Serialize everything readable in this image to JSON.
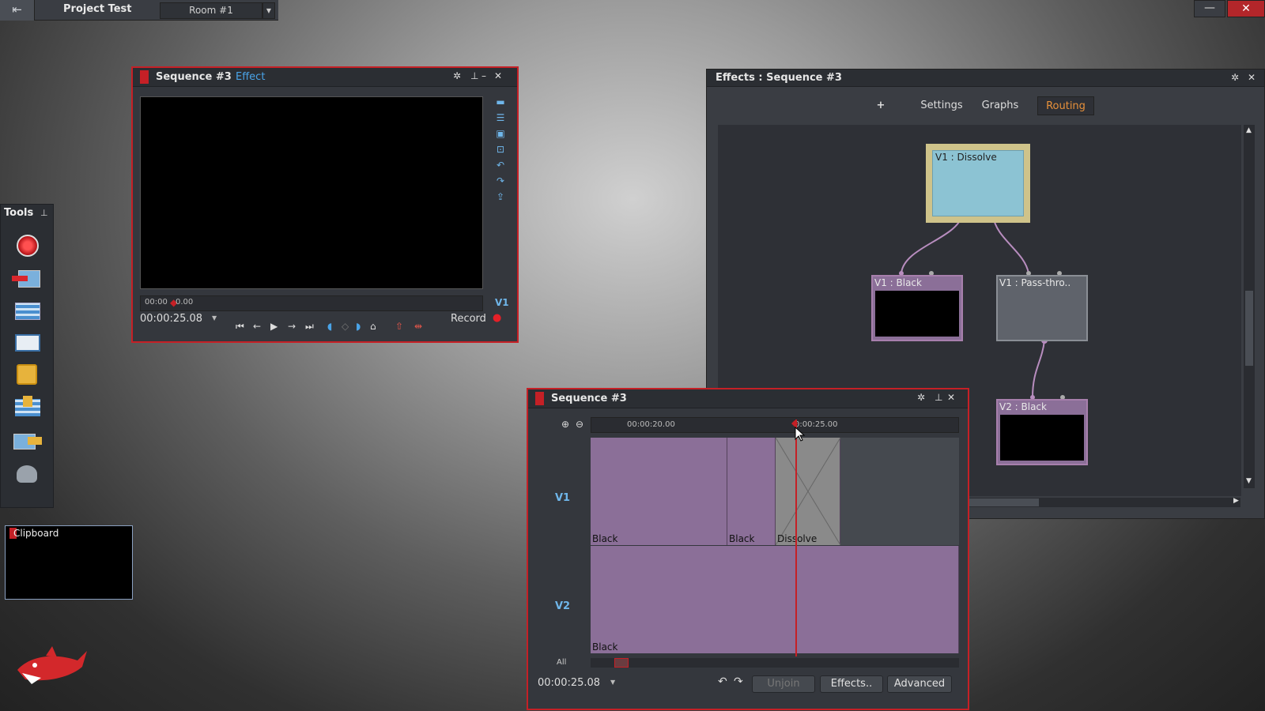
{
  "top_bar": {
    "project_title": "Project Test",
    "room": "Room #1",
    "exit_icon": "exit-icon",
    "dropdown_icon": "chevron-down-icon",
    "minimize_label": "—",
    "close_label": "✕"
  },
  "monitor": {
    "title": "Sequence #3",
    "subtitle": "Effect",
    "ruler_start": "00:00",
    "ruler_end": "0.00",
    "track_label": "V1",
    "timecode": "00:00:25.08",
    "record_label": "Record",
    "accent": "#c52026",
    "link_color": "#4aa4e8"
  },
  "effects": {
    "title": "Effects : Sequence #3",
    "tabs": [
      {
        "label": "+"
      },
      {
        "label": "Settings"
      },
      {
        "label": "Graphs"
      },
      {
        "label": "Routing"
      }
    ],
    "active_tab_color": "#e8913a",
    "nodes": [
      {
        "label": "V1 : Dissolve"
      },
      {
        "label": "V1 : Black"
      },
      {
        "label": "V1 : Pass-thro.."
      },
      {
        "label": "V2 : Black"
      }
    ]
  },
  "tools": {
    "title": "Tools",
    "items": [
      {
        "icon": "record-icon"
      },
      {
        "icon": "import-icon"
      },
      {
        "icon": "timeline-icon"
      },
      {
        "icon": "media-browser-icon"
      },
      {
        "icon": "image-icon"
      },
      {
        "icon": "render-icon"
      },
      {
        "icon": "export-icon"
      },
      {
        "icon": "settings-users-icon"
      }
    ]
  },
  "clipboard": {
    "title": "Clipboard"
  },
  "sequence": {
    "title": "Sequence #3",
    "ruler_labels": [
      "00:00:20.00",
      "0:00:25.00"
    ],
    "tracks": [
      {
        "label": "V1",
        "clips": [
          "Black",
          "Black",
          "Dissolve"
        ]
      },
      {
        "label": "V2",
        "clips": [
          "Black"
        ]
      }
    ],
    "all_label": "All",
    "timecode": "00:00:25.08",
    "buttons": {
      "unjoin": "Unjoin",
      "effects": "Effects..",
      "advanced": "Advanced"
    }
  }
}
